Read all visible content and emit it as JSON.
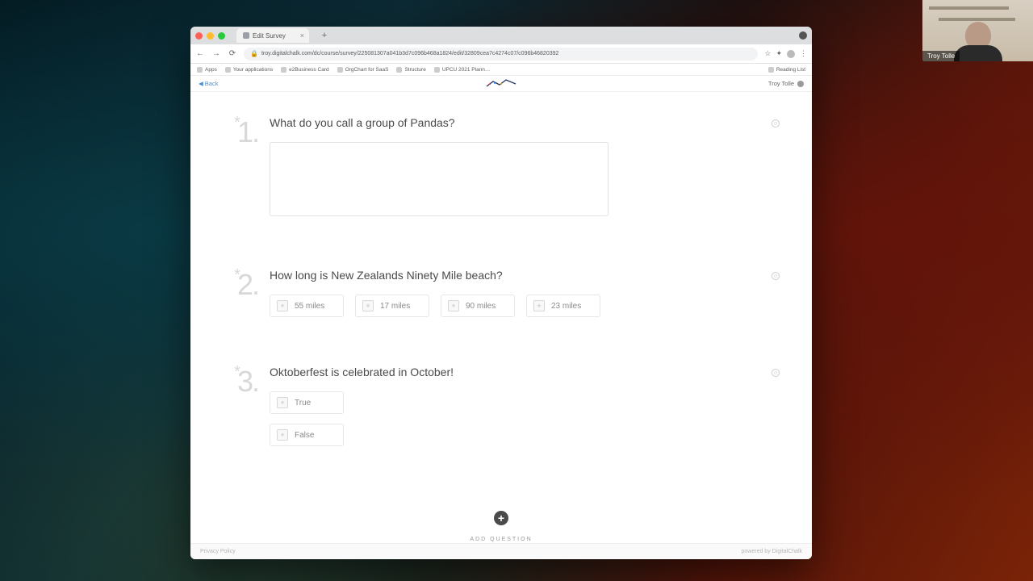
{
  "webcam": {
    "name": "Troy Tolle"
  },
  "browser": {
    "tab_title": "Edit Survey",
    "url": "troy.digitalchalk.com/dc/course/survey/225081307a041b3d7c096b468a1824/edit/32809cea7c4274c07/c096b46820392",
    "bookmarks": [
      "Apps",
      "Your applications",
      "e2Business Card",
      "OrgChart for SaaS",
      "Structure",
      "UPCU 2021 Plann…"
    ],
    "reading_list": "Reading List"
  },
  "app": {
    "back": "Back",
    "user": "Troy Tolle"
  },
  "questions": [
    {
      "num": "1.",
      "required": true,
      "title": "What do you call a group of Pandas?",
      "type": "text"
    },
    {
      "num": "2.",
      "required": true,
      "title": "How long is New Zealands Ninety Mile beach?",
      "type": "choice-h",
      "options": [
        "55 miles",
        "17 miles",
        "90 miles",
        "23 miles"
      ]
    },
    {
      "num": "3.",
      "required": true,
      "title": "Oktoberfest is celebrated in October!",
      "type": "choice-v",
      "options": [
        "True",
        "False"
      ]
    }
  ],
  "add_question": "ADD QUESTION",
  "footer": {
    "privacy": "Privacy Policy",
    "powered": "powered by DigitalChalk"
  }
}
